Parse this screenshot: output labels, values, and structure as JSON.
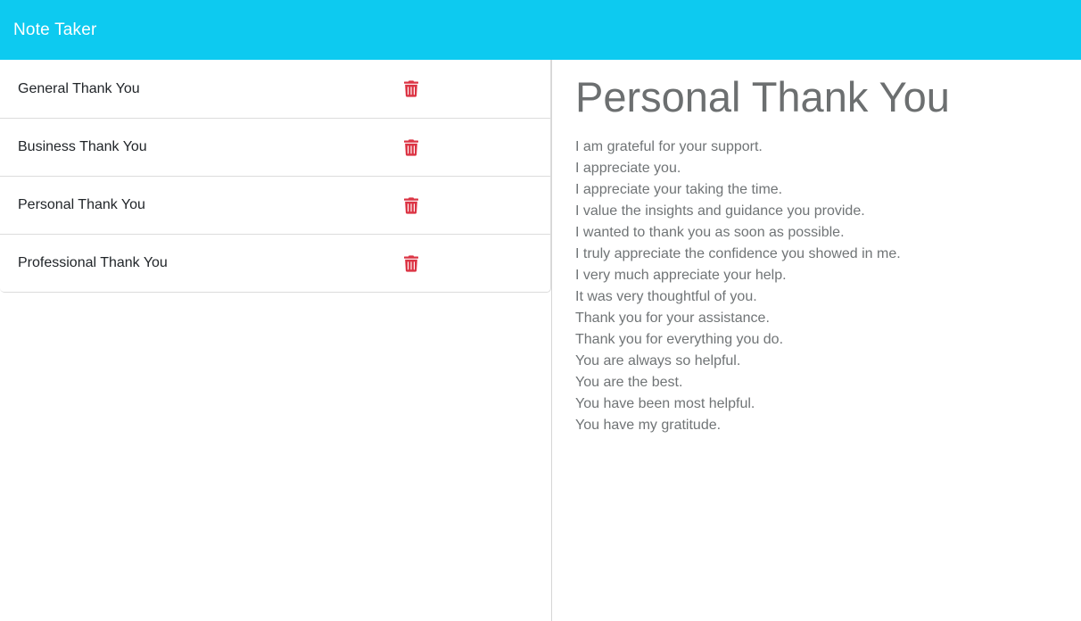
{
  "navbar": {
    "brand": "Note Taker"
  },
  "colors": {
    "navbar_bg": "#0dcaf0",
    "delete_icon": "#dc3545"
  },
  "notes": [
    {
      "title": "General Thank You",
      "icon": "trash-icon"
    },
    {
      "title": "Business Thank You",
      "icon": "trash-icon"
    },
    {
      "title": "Personal Thank You",
      "icon": "trash-icon"
    },
    {
      "title": "Professional Thank You",
      "icon": "trash-icon"
    }
  ],
  "active_note": {
    "title": "Personal Thank You",
    "lines": [
      "I am grateful for your support.",
      "I appreciate you.",
      "I appreciate your taking the time.",
      "I value the insights and guidance you provide.",
      "I wanted to thank you as soon as possible.",
      "I truly appreciate the confidence you showed in me.",
      "I very much appreciate your help.",
      "It was very thoughtful of you.",
      "Thank you for your assistance.",
      "Thank you for everything you do.",
      "You are always so helpful.",
      "You are the best.",
      "You have been most helpful.",
      "You have my gratitude."
    ]
  }
}
